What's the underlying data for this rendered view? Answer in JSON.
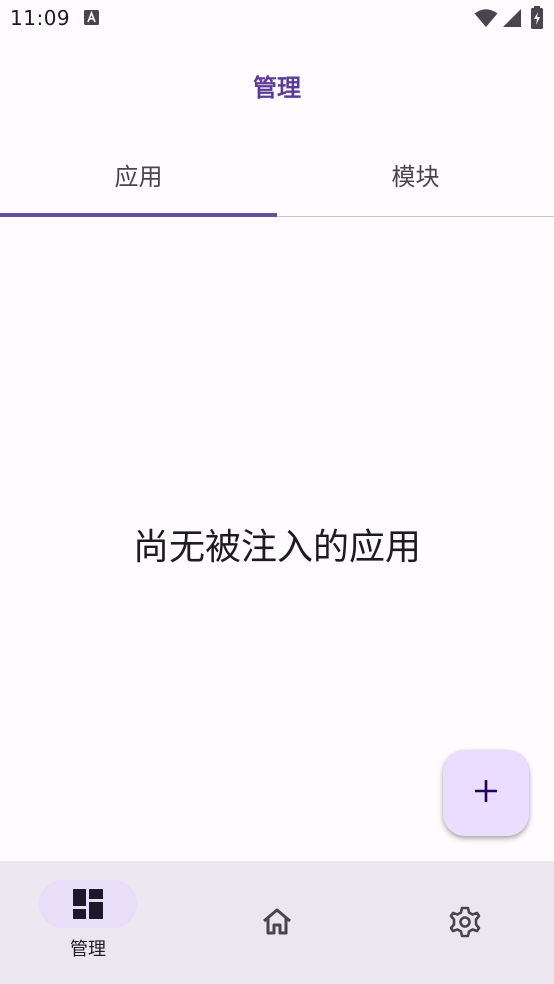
{
  "status_bar": {
    "time": "11:09",
    "icons": [
      "a-notification-icon",
      "wifi-icon",
      "signal-icon",
      "battery-icon"
    ]
  },
  "top_bar": {
    "title": "管理"
  },
  "tabs": [
    {
      "label": "应用",
      "selected": true
    },
    {
      "label": "模块",
      "selected": false
    }
  ],
  "content": {
    "empty_message": "尚无被注入的应用"
  },
  "fab": {
    "icon": "plus-icon"
  },
  "bottom_nav": {
    "items": [
      {
        "label": "管理",
        "icon": "dashboard-icon",
        "selected": true
      },
      {
        "label": "",
        "icon": "home-icon",
        "selected": false
      },
      {
        "label": "",
        "icon": "settings-icon",
        "selected": false
      }
    ]
  },
  "colors": {
    "accent": "#6750a4",
    "title": "#5c3b9a",
    "background": "#fffbfe",
    "fab": "#eaddff",
    "nav_background": "#ece6f0",
    "nav_indicator": "#e8def8"
  }
}
